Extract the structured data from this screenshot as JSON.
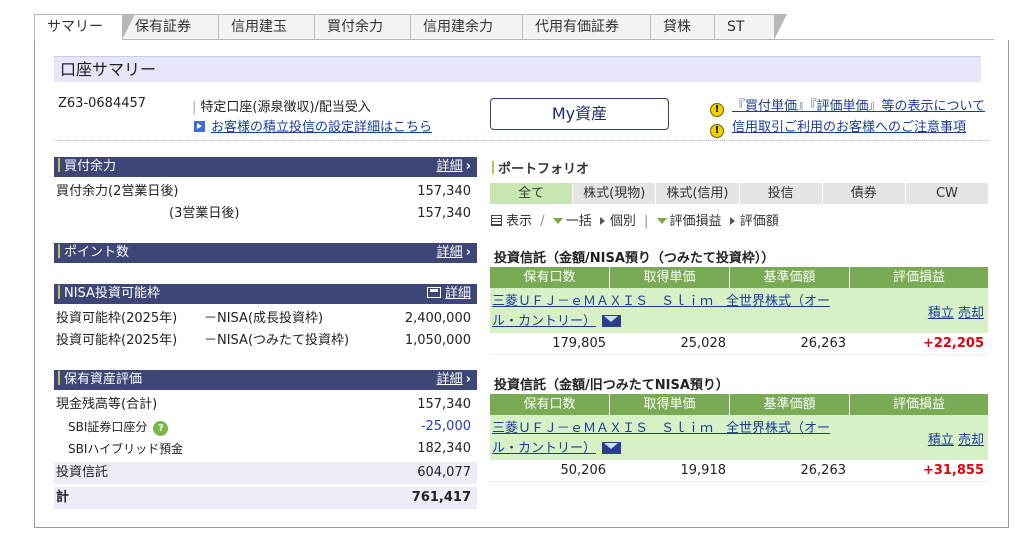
{
  "tabs": [
    "サマリー",
    "保有証券",
    "信用建玉",
    "買付余力",
    "信用建余力",
    "代用有価証券",
    "貸株",
    "ST"
  ],
  "summary_title": "口座サマリー",
  "account": {
    "number": "Z63-0684457",
    "type": "特定口座(源泉徴収)/配当受入",
    "tsumitate_link": "お客様の積立投信の設定詳細はこちら"
  },
  "my_asset_button": "My資産",
  "notices": [
    "『買付単価』『評価単価』等の表示について",
    "信用取引ご利用のお客様へのご注意事項"
  ],
  "buying_power": {
    "title": "買付余力",
    "more": "詳細",
    "rows": [
      {
        "label": "買付余力(2営業日後)",
        "value": "157,340"
      },
      {
        "label": "(3営業日後)",
        "value": "157,340"
      }
    ]
  },
  "points": {
    "title": "ポイント数",
    "more": "詳細"
  },
  "nisa": {
    "title": "NISA投資可能枠",
    "more": "詳細",
    "rows": [
      {
        "label": "投資可能枠(2025年)",
        "label2": "－NISA(成長投資枠)",
        "value": "2,400,000"
      },
      {
        "label": "投資可能枠(2025年)",
        "label2": "－NISA(つみたて投資枠)",
        "value": "1,050,000"
      }
    ]
  },
  "assets": {
    "title": "保有資産評価",
    "more": "詳細",
    "rows": [
      {
        "label": "現金残高等(合計)",
        "value": "157,340"
      },
      {
        "label": "SBI証券口座分",
        "value": "-25,000"
      },
      {
        "label": "SBIハイブリッド預金",
        "value": "182,340"
      },
      {
        "label": "投資信託",
        "value": "604,077"
      },
      {
        "label": "計",
        "value": "761,417"
      }
    ]
  },
  "portfolio": {
    "title": "ポートフォリオ",
    "tabs": [
      "全て",
      "株式(現物)",
      "株式(信用)",
      "投信",
      "債券",
      "CW"
    ],
    "controls": {
      "display": "表示",
      "bulk": "一括",
      "each": "個別",
      "pl": "評価損益",
      "amount": "評価額"
    },
    "columns": [
      "保有口数",
      "取得単価",
      "基準価額",
      "評価損益"
    ],
    "sections": [
      {
        "title": "投資信託（金額/NISA預り（つみたて投資枠））",
        "fund": "三菱ＵＦＪ－ｅＭＡＸＩＳ　Ｓｌｉｍ　全世界株式（オール・カントリー）",
        "actions": [
          "積立",
          "売却"
        ],
        "units": "179,805",
        "cost": "25,028",
        "nav": "26,263",
        "pl": "+22,205"
      },
      {
        "title": "投資信託（金額/旧つみたてNISA預り）",
        "fund": "三菱ＵＦＪ－ｅＭＡＸＩＳ　Ｓｌｉｍ　全世界株式（オール・カントリー）",
        "actions": [
          "積立",
          "売却"
        ],
        "units": "50,206",
        "cost": "19,918",
        "nav": "26,263",
        "pl": "+31,855"
      }
    ]
  },
  "colors": {
    "header_navy": "#3d4677",
    "portfolio_green": "#78ab53",
    "row_green": "#d7f0c6",
    "positive_red": "#e3000f",
    "negative_blue": "#1e3dc0"
  }
}
